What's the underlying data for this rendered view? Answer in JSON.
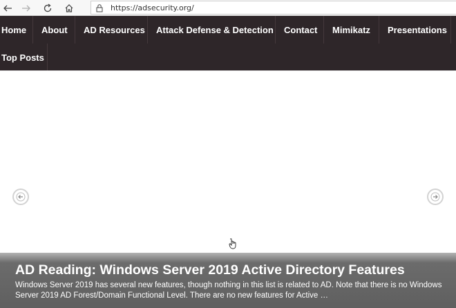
{
  "browser": {
    "url": "https://adsecurity.org/",
    "icons": [
      "back-arrow-icon",
      "forward-arrow-icon",
      "refresh-icon",
      "home-icon",
      "lock-icon"
    ]
  },
  "nav": {
    "items": [
      {
        "label": "Home"
      },
      {
        "label": "About"
      },
      {
        "label": "AD Resources"
      },
      {
        "label": "Attack Defense & Detection"
      },
      {
        "label": "Contact"
      },
      {
        "label": "Mimikatz"
      },
      {
        "label": "Presentations"
      },
      {
        "label": "Top Posts"
      }
    ]
  },
  "slider": {
    "title": "AD Reading: Windows Server 2019 Active Directory Features",
    "excerpt": "Windows Server 2019 has several new features, though nothing in this list is related to AD. Note that there is no Windows Server 2019 AD Forest/Domain Functional Level. There are no new features for Active …",
    "icons": [
      "prev-arrow-icon",
      "next-arrow-icon",
      "hand-cursor-icon"
    ]
  }
}
